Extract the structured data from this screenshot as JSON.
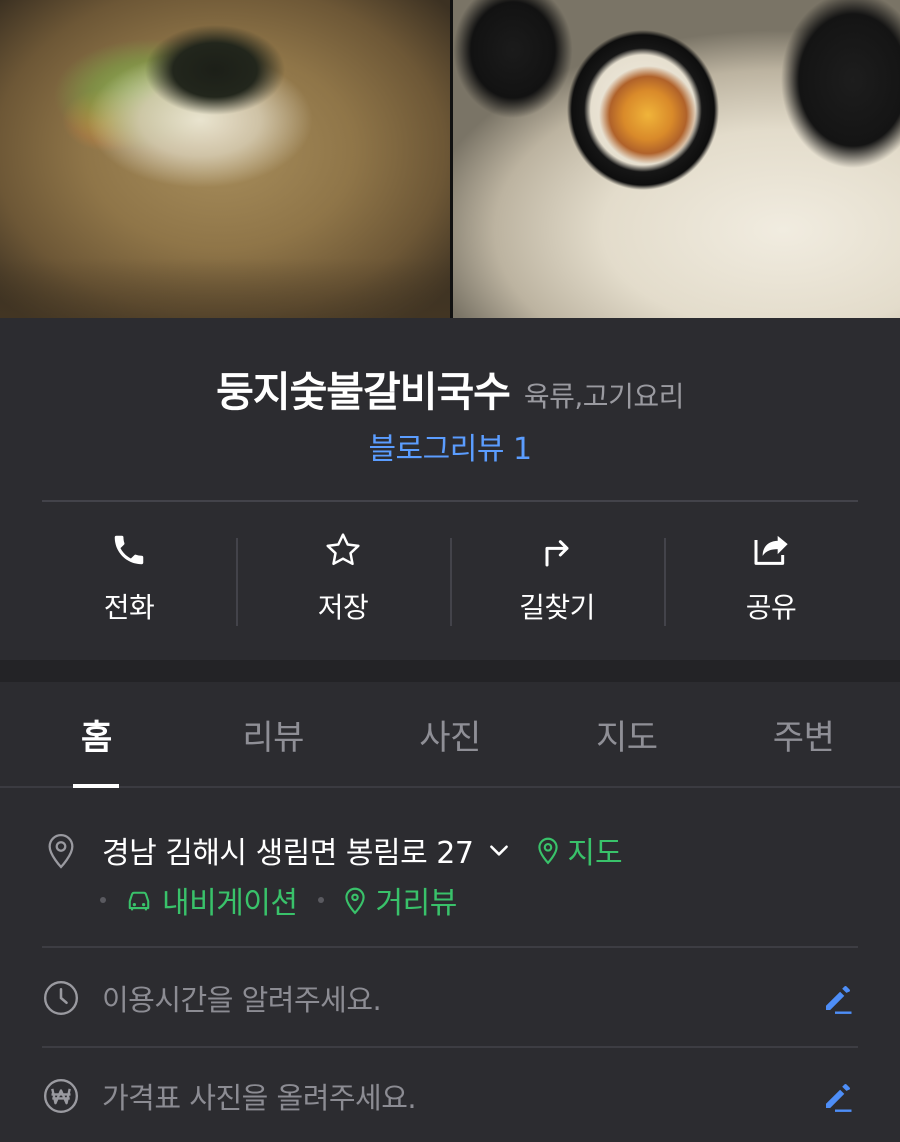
{
  "photos": [
    {
      "label": "cold noodle soup"
    },
    {
      "label": "gimbap rolls"
    }
  ],
  "place": {
    "name": "둥지숯불갈비국수",
    "category": "육류,고기요리",
    "blog_review": "블로그리뷰 1"
  },
  "actions": [
    {
      "label": "전화",
      "icon": "phone-icon"
    },
    {
      "label": "저장",
      "icon": "star-icon"
    },
    {
      "label": "길찾기",
      "icon": "directions-icon"
    },
    {
      "label": "공유",
      "icon": "share-icon"
    }
  ],
  "tabs": [
    {
      "label": "홈",
      "active": true
    },
    {
      "label": "리뷰",
      "active": false
    },
    {
      "label": "사진",
      "active": false
    },
    {
      "label": "지도",
      "active": false
    },
    {
      "label": "주변",
      "active": false
    }
  ],
  "details": {
    "address": "경남 김해시 생림면 봉림로 27",
    "map_link": "지도",
    "navigation_link": "내비게이션",
    "street_view_link": "거리뷰",
    "hours_placeholder": "이용시간을 알려주세요.",
    "price_placeholder": "가격표 사진을 올려주세요."
  },
  "colors": {
    "background": "#2c2c30",
    "link_blue": "#5b9dff",
    "link_green": "#39c26a",
    "muted_text": "#8c8c93"
  }
}
